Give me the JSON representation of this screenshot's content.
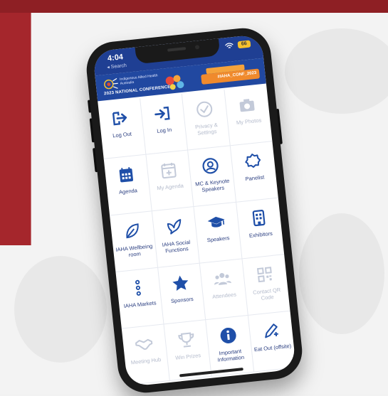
{
  "status": {
    "time": "4:04",
    "back": "◂ Search",
    "battery": "66"
  },
  "banner": {
    "org": "Indigenous Allied Health Australia",
    "conference": "2023 NATIONAL CONFERENCE",
    "cta": "#IAHA_CONF_2023"
  },
  "colors": {
    "primary": "#1f4fa8",
    "disabled": "#c3cad9",
    "bg_red": "#a5262c"
  },
  "tiles": [
    {
      "label": "Log Out",
      "icon": "logout-icon",
      "enabled": true
    },
    {
      "label": "Log In",
      "icon": "login-icon",
      "enabled": true
    },
    {
      "label": "Privacy & Settings",
      "icon": "check-circle-icon",
      "enabled": false
    },
    {
      "label": "My Photos",
      "icon": "camera-icon",
      "enabled": false
    },
    {
      "label": "Agenda",
      "icon": "calendar-icon",
      "enabled": true
    },
    {
      "label": "My Agenda",
      "icon": "calendar-plus-icon",
      "enabled": false
    },
    {
      "label": "MC & Keynote Speakers",
      "icon": "speaker-portrait-icon",
      "enabled": true
    },
    {
      "label": "Panelist",
      "icon": "badge-icon",
      "enabled": true
    },
    {
      "label": "IAHA Wellbeing room",
      "icon": "leaf-icon",
      "enabled": true
    },
    {
      "label": "IAHA Social Functions",
      "icon": "dove-icon",
      "enabled": true
    },
    {
      "label": "Speakers",
      "icon": "graduation-cap-icon",
      "enabled": true
    },
    {
      "label": "Exhibitors",
      "icon": "building-icon",
      "enabled": true
    },
    {
      "label": "IAHA Markets",
      "icon": "dots-vertical-icon",
      "enabled": true
    },
    {
      "label": "Sponsors",
      "icon": "star-icon",
      "enabled": true
    },
    {
      "label": "Attendees",
      "icon": "people-icon",
      "enabled": false
    },
    {
      "label": "Contact QR Code",
      "icon": "qr-code-icon",
      "enabled": false
    },
    {
      "label": "Meeting Hub",
      "icon": "handshake-icon",
      "enabled": false
    },
    {
      "label": "Win Prizes",
      "icon": "trophy-icon",
      "enabled": false
    },
    {
      "label": "Important Information",
      "icon": "info-icon",
      "enabled": true
    },
    {
      "label": "Eat Out (offsite)",
      "icon": "pen-icon",
      "enabled": true
    }
  ]
}
